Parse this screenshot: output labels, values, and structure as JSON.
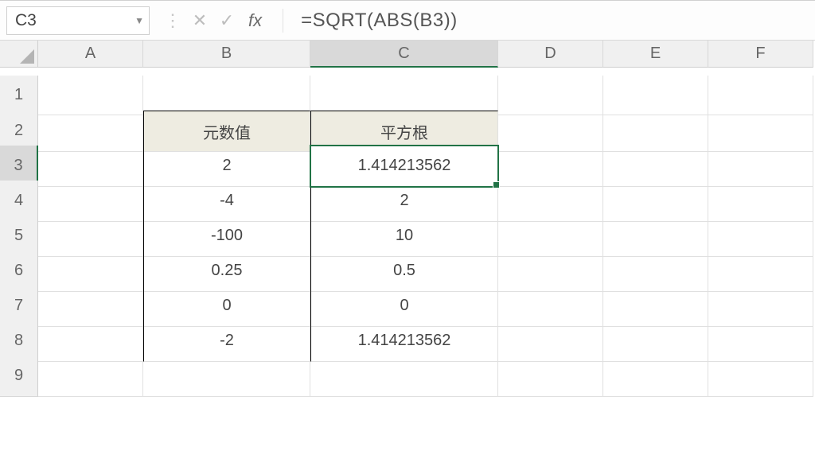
{
  "namebox": {
    "value": "C3"
  },
  "formula_bar": {
    "fx_label": "fx",
    "formula": "=SQRT(ABS(B3))"
  },
  "columns": [
    "A",
    "B",
    "C",
    "D",
    "E",
    "F"
  ],
  "row_numbers": [
    "1",
    "2",
    "3",
    "4",
    "5",
    "6",
    "7",
    "8",
    "9"
  ],
  "active": {
    "col": "C",
    "row": "3",
    "cell": "C3"
  },
  "data_table": {
    "headers": {
      "B": "元数值",
      "C": "平方根"
    },
    "rows": [
      {
        "B": "2",
        "C": "1.414213562"
      },
      {
        "B": "-4",
        "C": "2"
      },
      {
        "B": "-100",
        "C": "10"
      },
      {
        "B": "0.25",
        "C": "0.5"
      },
      {
        "B": "0",
        "C": "0"
      },
      {
        "B": "-2",
        "C": "1.414213562"
      }
    ]
  },
  "chart_data": {
    "type": "table",
    "columns": [
      "元数值",
      "平方根"
    ],
    "rows": [
      [
        2,
        1.414213562
      ],
      [
        -4,
        2
      ],
      [
        -100,
        10
      ],
      [
        0.25,
        0.5
      ],
      [
        0,
        0
      ],
      [
        -2,
        1.414213562
      ]
    ]
  }
}
